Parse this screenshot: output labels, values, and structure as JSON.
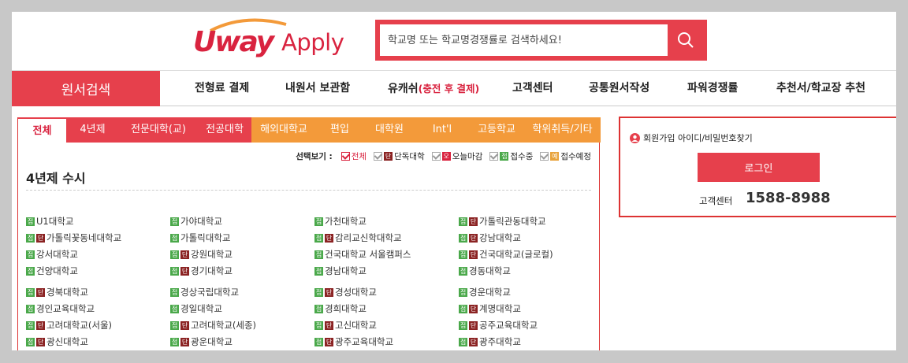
{
  "header": {
    "logo_main": "Uway",
    "logo_sub": "Apply",
    "search_placeholder": "학교명 또는 학교명경쟁률로 검색하세요!",
    "search_icon": "magnifier-icon"
  },
  "nav": {
    "search_label": "원서검색",
    "items": [
      {
        "label": "전형료 결제"
      },
      {
        "label": "내원서 보관함"
      },
      {
        "label": "유캐쉬",
        "highlight": "(충전 후 결제)"
      },
      {
        "label": "고객센터"
      },
      {
        "label": "공통원서작성"
      },
      {
        "label": "파워경쟁률"
      },
      {
        "label": "추천서/학교장 추천"
      }
    ]
  },
  "tabs": [
    "전체",
    "4년제",
    "전문대학(교)",
    "전공대학",
    "해외대학교",
    "편입",
    "대학원",
    "Int'l",
    "고등학교",
    "학위취득/기타"
  ],
  "filters": {
    "label": "선택보기 :",
    "all": "전체",
    "dan": "단독대학",
    "today": "오늘마감",
    "ing": "접수중",
    "yet": "접수예정",
    "dan_badge": "단",
    "today_badge": "오",
    "ing_badge": "접",
    "yet_badge": "예"
  },
  "section_title": "4년제 수시",
  "universities": [
    [
      {
        "n": "U1대학교",
        "b": [
          "접"
        ]
      },
      {
        "n": "가야대학교",
        "b": [
          "접"
        ]
      },
      {
        "n": "가천대학교",
        "b": [
          "접"
        ]
      },
      {
        "n": "가톨릭관동대학교",
        "b": [
          "접",
          "단"
        ]
      }
    ],
    [
      {
        "n": "가톨릭꽃동네대학교",
        "b": [
          "접",
          "단"
        ]
      },
      {
        "n": "가톨릭대학교",
        "b": [
          "접"
        ]
      },
      {
        "n": "감리교신학대학교",
        "b": [
          "접",
          "단"
        ]
      },
      {
        "n": "강남대학교",
        "b": [
          "접",
          "단"
        ]
      }
    ],
    [
      {
        "n": "강서대학교",
        "b": [
          "접"
        ]
      },
      {
        "n": "강원대학교",
        "b": [
          "접",
          "단"
        ]
      },
      {
        "n": "건국대학교 서울캠퍼스",
        "b": [
          "접"
        ]
      },
      {
        "n": "건국대학교(글로컬)",
        "b": [
          "접",
          "단"
        ]
      }
    ],
    [
      {
        "n": "건양대학교",
        "b": [
          "접"
        ]
      },
      {
        "n": "경기대학교",
        "b": [
          "접",
          "단"
        ]
      },
      {
        "n": "경남대학교",
        "b": [
          "접"
        ]
      },
      {
        "n": "경동대학교",
        "b": [
          "접"
        ]
      }
    ],
    [
      {
        "n": "경북대학교",
        "b": [
          "접",
          "단"
        ]
      },
      {
        "n": "경상국립대학교",
        "b": [
          "접"
        ]
      },
      {
        "n": "경성대학교",
        "b": [
          "접",
          "단"
        ]
      },
      {
        "n": "경운대학교",
        "b": [
          "접"
        ]
      }
    ],
    [
      {
        "n": "경인교육대학교",
        "b": [
          "접"
        ]
      },
      {
        "n": "경일대학교",
        "b": [
          "접"
        ]
      },
      {
        "n": "경희대학교",
        "b": [
          "접"
        ]
      },
      {
        "n": "계명대학교",
        "b": [
          "접",
          "단"
        ]
      }
    ],
    [
      {
        "n": "고려대학교(서울)",
        "b": [
          "접",
          "단"
        ]
      },
      {
        "n": "고려대학교(세종)",
        "b": [
          "접",
          "단"
        ]
      },
      {
        "n": "고신대학교",
        "b": [
          "접",
          "단"
        ]
      },
      {
        "n": "공주교육대학교",
        "b": [
          "접",
          "단"
        ]
      }
    ],
    [
      {
        "n": "광신대학교",
        "b": [
          "접",
          "단"
        ]
      },
      {
        "n": "광운대학교",
        "b": [
          "접",
          "단"
        ]
      },
      {
        "n": "광주교육대학교",
        "b": [
          "접",
          "단"
        ]
      },
      {
        "n": "광주대학교",
        "b": [
          "접",
          "단"
        ]
      }
    ]
  ],
  "login_panel": {
    "member_link": "회원가입  아이디/비밀번호찾기",
    "login_label": "로그인",
    "cs_label": "고객센터",
    "cs_number": "1588-8988"
  },
  "colors": {
    "accent": "#e6404c",
    "orange": "#f39a3a",
    "dan": "#8b2323",
    "ing": "#4aa84a"
  }
}
